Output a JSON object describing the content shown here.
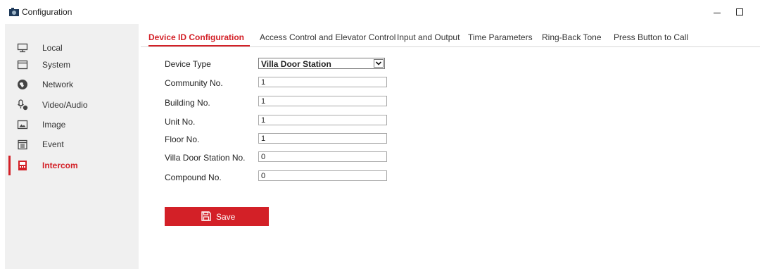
{
  "window": {
    "title": "Configuration",
    "icon": "camera-icon",
    "controls": {
      "minimize": "minimize-icon",
      "maximize": "maximize-icon"
    }
  },
  "sidebar": {
    "items": [
      {
        "label": "Local",
        "icon": "monitor-icon",
        "active": false
      },
      {
        "label": "System",
        "icon": "window-icon",
        "active": false
      },
      {
        "label": "Network",
        "icon": "globe-icon",
        "active": false
      },
      {
        "label": "Video/Audio",
        "icon": "microphone-icon",
        "active": false
      },
      {
        "label": "Image",
        "icon": "image-icon",
        "active": false
      },
      {
        "label": "Event",
        "icon": "calendar-icon",
        "active": false
      },
      {
        "label": "Intercom",
        "icon": "intercom-icon",
        "active": true
      }
    ]
  },
  "tabs": [
    {
      "label": "Device ID Configuration",
      "active": true
    },
    {
      "label": "Access Control and Elevator Control",
      "active": false
    },
    {
      "label": "Input and Output",
      "active": false
    },
    {
      "label": "Time Parameters",
      "active": false
    },
    {
      "label": "Ring-Back Tone",
      "active": false
    },
    {
      "label": "Press Button to Call",
      "active": false
    }
  ],
  "form": {
    "device_type": {
      "label": "Device Type",
      "value": "Villa Door Station"
    },
    "fields": [
      {
        "label": "Community No.",
        "value": "1"
      },
      {
        "label": "Building No.",
        "value": "1"
      },
      {
        "label": "Unit No.",
        "value": "1"
      },
      {
        "label": "Floor No.",
        "value": "1"
      },
      {
        "label": "Villa Door Station No.",
        "value": "0"
      },
      {
        "label": "Compound No.",
        "value": "0"
      }
    ]
  },
  "actions": {
    "save_label": "Save"
  },
  "colors": {
    "accent": "#d32027",
    "sidebar_bg": "#f0f0f0"
  }
}
